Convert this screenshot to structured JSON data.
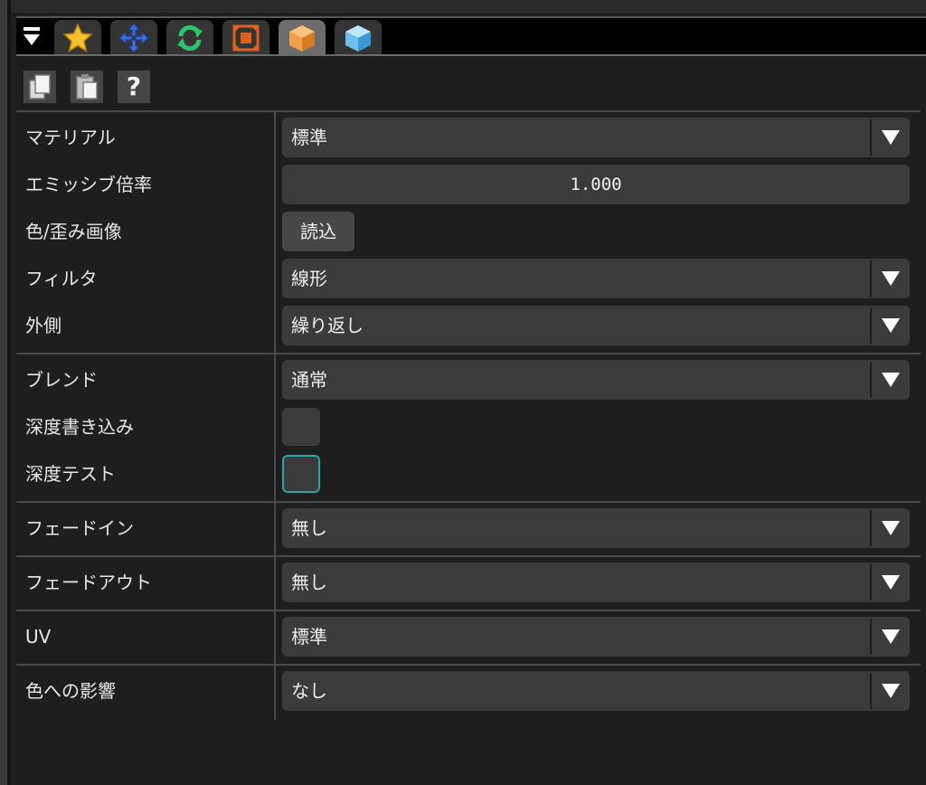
{
  "tabs": [
    {
      "icon": "star-icon",
      "color": "#f5c12e"
    },
    {
      "icon": "move-arrows-icon",
      "color": "#3a6cd8"
    },
    {
      "icon": "rotate-icon",
      "color": "#2ec46a"
    },
    {
      "icon": "scale-icon",
      "color": "#e0601c"
    },
    {
      "icon": "orange-cube-icon",
      "color": "#f0a04a"
    },
    {
      "icon": "blue-cube-icon",
      "color": "#6ec0ee"
    }
  ],
  "toolbar": {
    "help_label": "?"
  },
  "properties": {
    "material": {
      "label": "マテリアル",
      "value": "標準"
    },
    "emissive": {
      "label": "エミッシブ倍率",
      "value": "1.000"
    },
    "image": {
      "label": "色/歪み画像",
      "button": "読込"
    },
    "filter": {
      "label": "フィルタ",
      "value": "線形"
    },
    "outside": {
      "label": "外側",
      "value": "繰り返し"
    },
    "blend": {
      "label": "ブレンド",
      "value": "通常"
    },
    "depth_write": {
      "label": "深度書き込み",
      "checked": false
    },
    "depth_test": {
      "label": "深度テスト",
      "checked": false
    },
    "fade_in": {
      "label": "フェードイン",
      "value": "無し"
    },
    "fade_out": {
      "label": "フェードアウト",
      "value": "無し"
    },
    "uv": {
      "label": "UV",
      "value": "標準"
    },
    "color_influence": {
      "label": "色への影響",
      "value": "なし"
    }
  },
  "colors": {
    "background": "#1e1e1e",
    "field": "#3b3b3b",
    "focus": "#2aa6a6"
  }
}
